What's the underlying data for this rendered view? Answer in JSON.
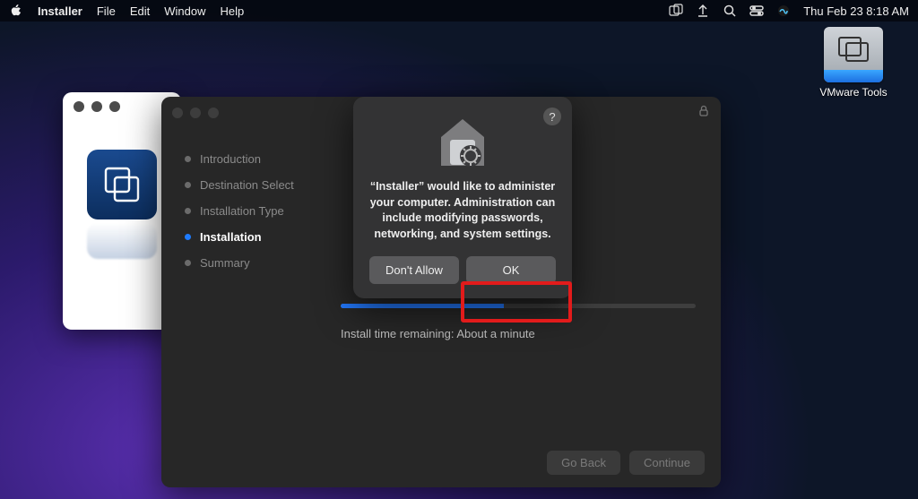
{
  "menubar": {
    "app": "Installer",
    "items": [
      "File",
      "Edit",
      "Window",
      "Help"
    ],
    "clock": "Thu Feb 23  8:18 AM"
  },
  "desktop": {
    "vmware_label": "VMware Tools"
  },
  "installer": {
    "steps": [
      "Introduction",
      "Destination Select",
      "Installation Type",
      "Installation",
      "Summary"
    ],
    "active_index": 3,
    "status": "Install time remaining: About a minute",
    "go_back": "Go Back",
    "continue": "Continue"
  },
  "dialog": {
    "message": "“Installer” would like to administer your computer. Administration can include modifying passwords, networking, and system settings.",
    "deny": "Don't Allow",
    "allow": "OK",
    "help": "?"
  }
}
